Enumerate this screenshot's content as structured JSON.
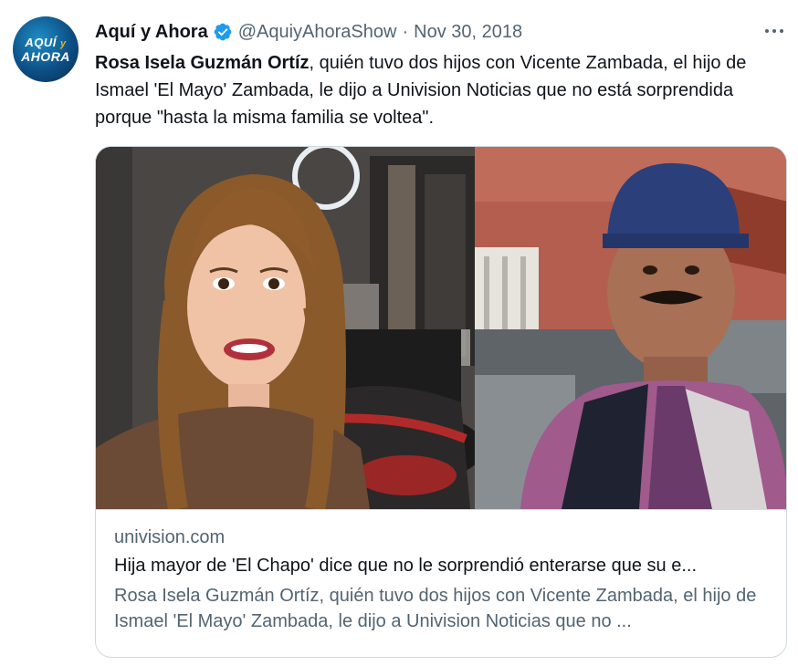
{
  "account": {
    "display_name": "Aquí y Ahora",
    "handle": "@AquiyAhoraShow",
    "separator": "·",
    "date": "Nov 30, 2018",
    "avatar_logo_line1": "AQUÍ",
    "avatar_logo_y": "y",
    "avatar_logo_line2": "AHORA",
    "verified_color": "#1d9bf0"
  },
  "tweet": {
    "bold_name": "Rosa Isela Guzmán Ortíz",
    "text": ", quién tuvo dos hijos con Vicente Zambada, el hijo de Ismael 'El Mayo' Zambada, le dijo a Univision Noticias que no está sorprendida porque \"hasta la misma familia se voltea\"."
  },
  "card": {
    "domain": "univision.com",
    "title": "Hija mayor de 'El Chapo' dice que no le sorprendió enterarse que su e...",
    "description": "Rosa Isela Guzmán Ortíz, quién tuvo dos hijos con Vicente Zambada, el hijo de Ismael 'El Mayo' Zambada, le dijo a Univision Noticias que no ..."
  },
  "icons": {
    "verified": "verified-badge-icon",
    "more": "more-options-icon"
  }
}
